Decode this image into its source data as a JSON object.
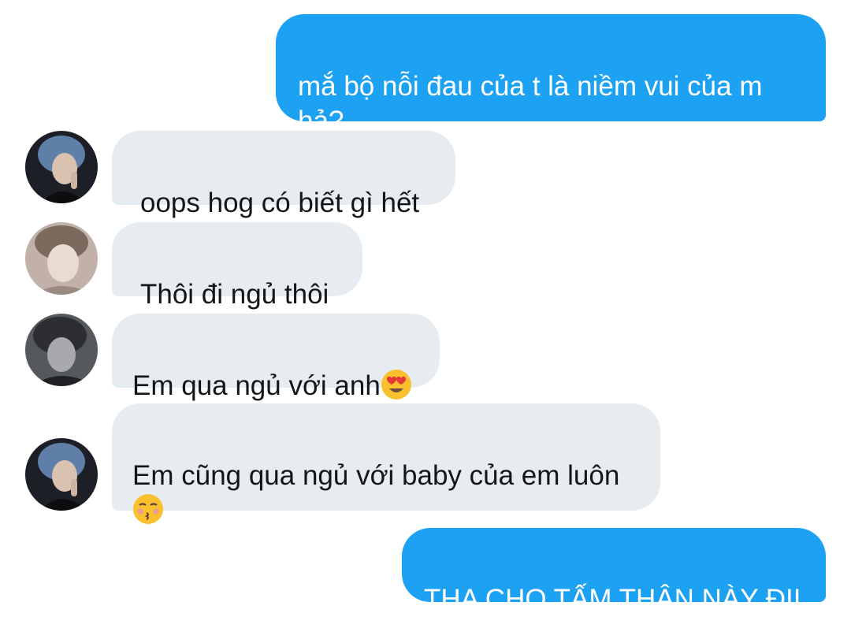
{
  "messages": [
    {
      "side": "outgoing",
      "text": "mắ bộ nỗi đau của t là niềm vui của m\nhả?"
    },
    {
      "side": "incoming",
      "avatar": "avatar-1",
      "text": "oops hog có biết gì hết"
    },
    {
      "side": "incoming",
      "avatar": "avatar-2",
      "text": "Thôi đi ngủ thôi"
    },
    {
      "side": "incoming",
      "avatar": "avatar-3",
      "text": "Em qua ngủ với anh",
      "emoji": "heart-eyes-emoji"
    },
    {
      "side": "incoming",
      "avatar": "avatar-1",
      "text": "Em cũng qua ngủ với baby của em luôn",
      "emoji": "kissing-closed-eyes-emoji"
    },
    {
      "side": "outgoing",
      "text": "THA CHO TẤM THÂN NÀY ĐII"
    }
  ],
  "colors": {
    "outgoing_bubble": "#1da1f2",
    "incoming_bubble": "#e6ecf0",
    "outgoing_text": "#ffffff",
    "incoming_text": "#14171a"
  }
}
